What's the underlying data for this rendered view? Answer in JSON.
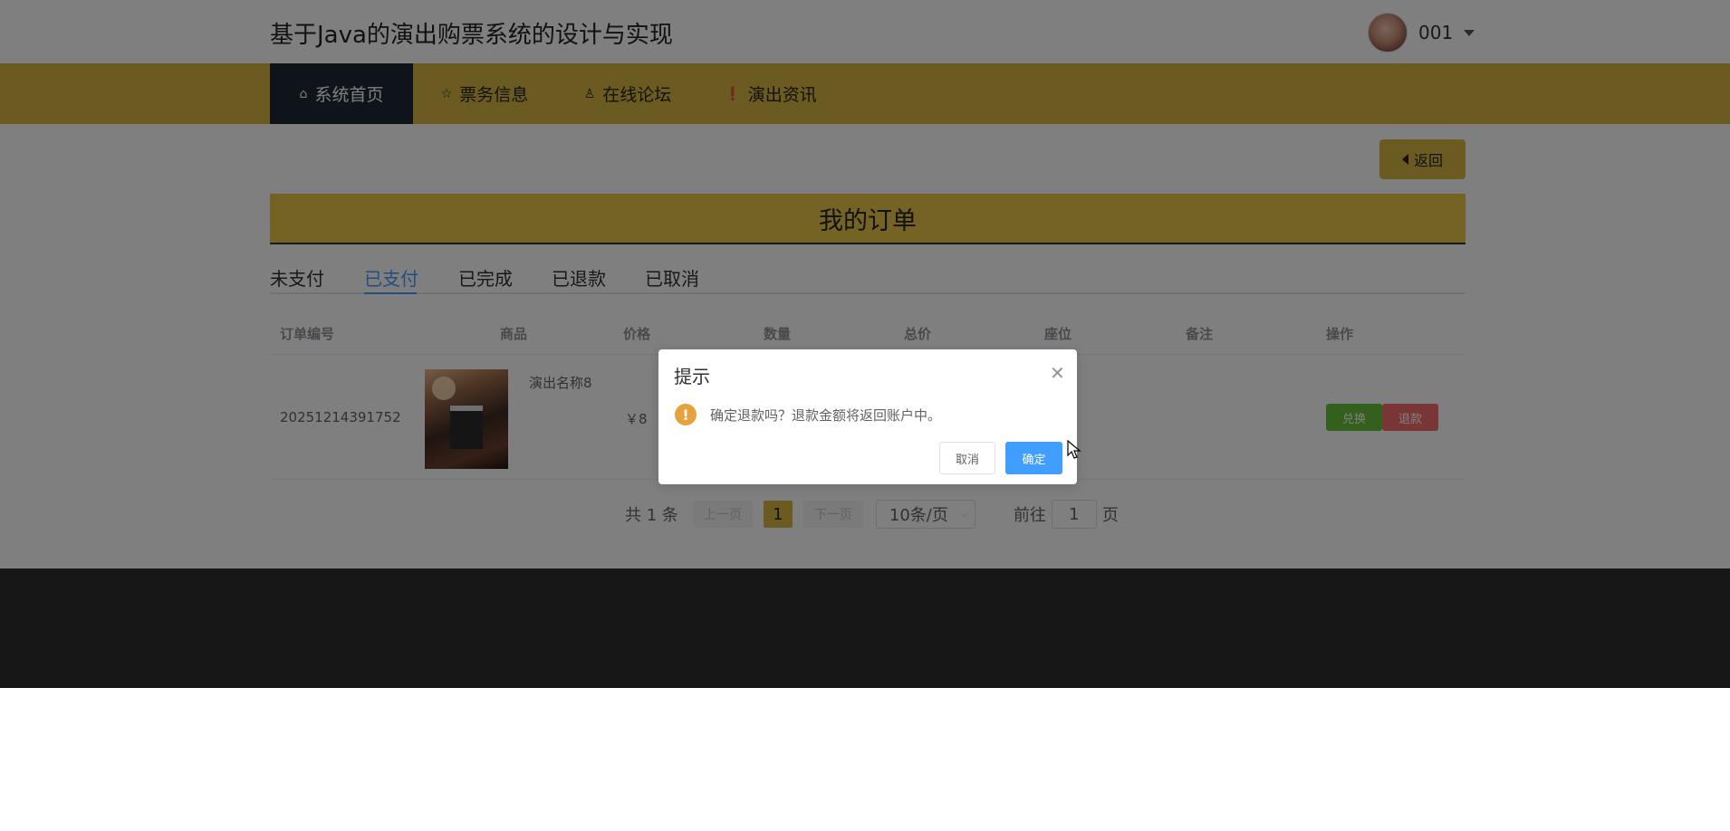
{
  "header": {
    "site_title": "基于Java的演出购票系统的设计与实现",
    "user_name": "001"
  },
  "nav": {
    "items": [
      {
        "icon": "⌂",
        "label": "系统首页",
        "active": true
      },
      {
        "icon": "☆",
        "label": "票务信息",
        "active": false
      },
      {
        "icon": "♙",
        "label": "在线论坛",
        "active": false
      },
      {
        "icon": "❗",
        "label": "演出资讯",
        "active": false
      }
    ]
  },
  "back_button": "返回",
  "section_title": "我的订单",
  "tabs": [
    "未支付",
    "已支付",
    "已完成",
    "已退款",
    "已取消"
  ],
  "active_tab": "已支付",
  "table": {
    "headers": [
      "订单编号",
      "商品",
      "价格",
      "数量",
      "总价",
      "座位",
      "备注",
      "操作"
    ],
    "rows": [
      {
        "order_no": "20251214391752",
        "product_name": "演出名称8",
        "price": "￥8",
        "actions": [
          "兑换",
          "退款"
        ]
      }
    ]
  },
  "pagination": {
    "total": "共 1 条",
    "prev": "上一页",
    "current_page": "1",
    "next": "下一页",
    "page_size": "10条/页",
    "goto_label": "前往",
    "goto_value": "1",
    "page_suffix": "页"
  },
  "dialog": {
    "title": "提示",
    "message": "确定退款吗？退款金额将返回账户中。",
    "cancel": "取消",
    "confirm": "确定"
  },
  "colors": {
    "accent_yellow": "#d9b740",
    "nav_active": "#1f2937",
    "primary_blue": "#409eff",
    "success_green": "#67c23a",
    "danger_red": "#f56c6c",
    "warning_orange": "#e6a23c"
  }
}
